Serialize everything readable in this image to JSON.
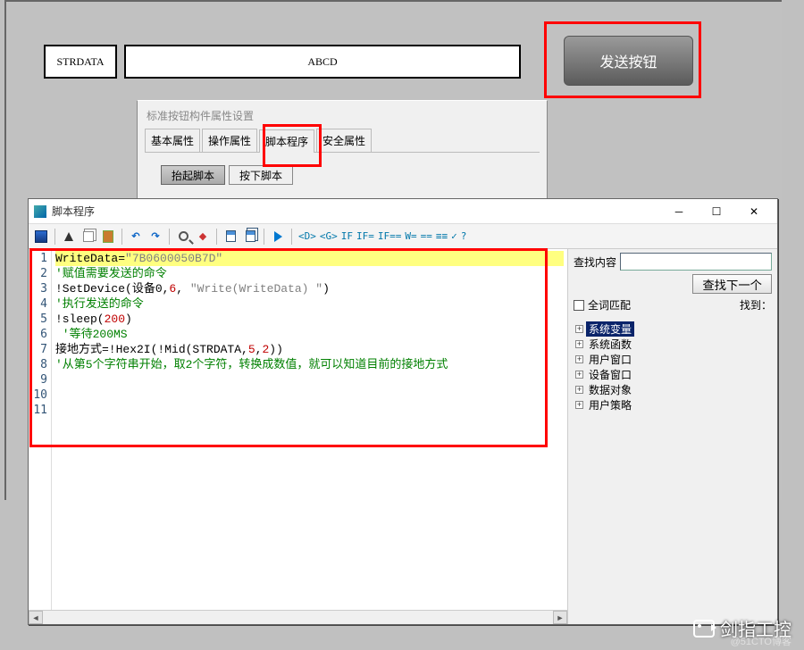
{
  "top": {
    "strdata_label": "STRDATA",
    "abcd_value": "ABCD",
    "send_button": "发送按钮"
  },
  "prop_dialog": {
    "title": "标准按钮构件属性设置",
    "tabs": [
      "基本属性",
      "操作属性",
      "脚本程序",
      "安全属性"
    ],
    "selected_tab_index": 2,
    "subtabs": [
      "抬起脚本",
      "按下脚本"
    ],
    "selected_subtab_index": 0
  },
  "editor": {
    "window_title": "脚本程序",
    "toolbar_text_buttons": [
      "<D>",
      "<G>",
      "IF",
      "IF=",
      "IF==",
      "W=",
      "==",
      "≡≡",
      "✓",
      "?"
    ],
    "code_lines": [
      {
        "n": 1,
        "hl": true,
        "segs": [
          {
            "t": "WriteData=",
            "c": "blk"
          },
          {
            "t": "\"7B0600050B7D\"",
            "c": "str"
          }
        ]
      },
      {
        "n": 2,
        "segs": [
          {
            "t": "'赋值需要发送的命令",
            "c": "grn"
          }
        ]
      },
      {
        "n": 3,
        "segs": [
          {
            "t": "",
            "c": "blk"
          }
        ]
      },
      {
        "n": 4,
        "segs": [
          {
            "t": "!SetDevice(设备0,",
            "c": "blk"
          },
          {
            "t": "6",
            "c": "red"
          },
          {
            "t": ", ",
            "c": "blk"
          },
          {
            "t": "\"Write(WriteData) \"",
            "c": "str"
          },
          {
            "t": ")",
            "c": "blk"
          }
        ]
      },
      {
        "n": 5,
        "segs": [
          {
            "t": "'执行发送的命令",
            "c": "grn"
          }
        ]
      },
      {
        "n": 6,
        "segs": [
          {
            "t": "",
            "c": "blk"
          }
        ]
      },
      {
        "n": 7,
        "segs": [
          {
            "t": "!sleep(",
            "c": "blk"
          },
          {
            "t": "200",
            "c": "red"
          },
          {
            "t": ")",
            "c": "blk"
          }
        ]
      },
      {
        "n": 8,
        "segs": [
          {
            "t": " '等待200MS",
            "c": "grn"
          }
        ]
      },
      {
        "n": 9,
        "segs": [
          {
            "t": "",
            "c": "blk"
          }
        ]
      },
      {
        "n": 10,
        "segs": [
          {
            "t": "接地方式=!Hex2I(!Mid(STRDATA,",
            "c": "blk"
          },
          {
            "t": "5",
            "c": "red"
          },
          {
            "t": ",",
            "c": "blk"
          },
          {
            "t": "2",
            "c": "red"
          },
          {
            "t": "))",
            "c": "blk"
          }
        ]
      },
      {
        "n": 11,
        "segs": [
          {
            "t": "'从第5个字符串开始，取2个字符，转换成数值，就可以知道目前的接地方式",
            "c": "grn"
          }
        ]
      }
    ],
    "side": {
      "find_label": "查找内容",
      "find_next_btn": "查找下一个",
      "whole_word": "全词匹配",
      "found_label": "找到：",
      "tree": [
        "系统变量",
        "系统函数",
        "用户窗口",
        "设备窗口",
        "数据对象",
        "用户策略"
      ],
      "tree_selected_index": 0
    }
  },
  "watermark": {
    "main": "剑指工控",
    "sub": "@51CTO博客"
  }
}
